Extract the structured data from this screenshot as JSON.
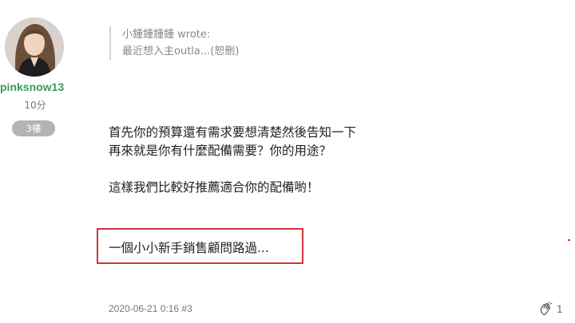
{
  "author": {
    "username": "pinksnow13",
    "score": "10分",
    "floor": "3樓"
  },
  "quote": {
    "header": "小鍾鍾鍾鍾 wrote:",
    "excerpt": "最近想入主outla...(恕刪)"
  },
  "post": {
    "lines": [
      "首先你的預算還有需求要想清楚然後告知一下",
      "再來就是你有什麼配備需要？你的用途？",
      "",
      "這樣我們比較好推薦適合你的配備喲！"
    ],
    "signature": "一個小小新手銷售顧問路過...",
    "meta": "2020-06-21 0:16 #3",
    "like_count": "1"
  },
  "colors": {
    "username": "#3a9a5b",
    "highlight_border": "#d0333b",
    "badge_bg": "#b3b3b3"
  },
  "icons": {
    "like": "clap-hands-icon"
  }
}
